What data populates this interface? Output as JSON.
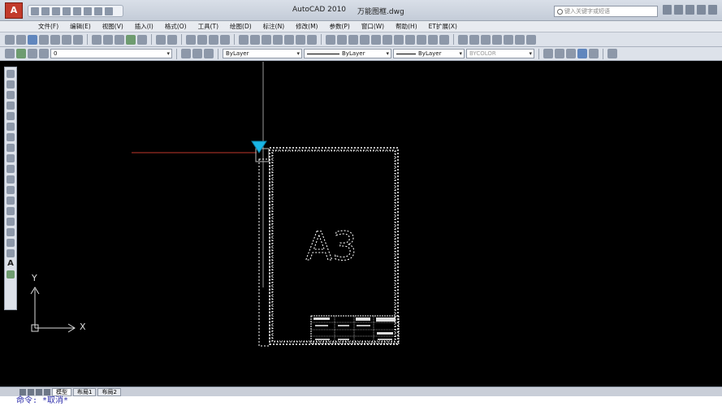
{
  "title": {
    "app": "AutoCAD 2010",
    "file": "万能图框.dwg",
    "search_placeholder": "键入关键字或短语"
  },
  "menu": [
    "文件(F)",
    "编辑(E)",
    "视图(V)",
    "插入(I)",
    "格式(O)",
    "工具(T)",
    "绘图(D)",
    "标注(N)",
    "修改(M)",
    "参数(P)",
    "窗口(W)",
    "帮助(H)",
    "ET扩展(X)"
  ],
  "layer": {
    "current": "0",
    "color": "ByLayer",
    "linetype": "ByLayer",
    "lineweight": "ByLayer",
    "plotstyle": "BYCOLOR"
  },
  "drawing": {
    "frame_label": "A3"
  },
  "ucs": {
    "x_label": "X",
    "y_label": "Y"
  },
  "tabs": [
    "模型",
    "布局1",
    "布局2"
  ],
  "command": {
    "text": "命令: *取消*"
  },
  "colors": {
    "crosshair": "#9a9a9a",
    "xaxis": "#c0392b",
    "grip": "#19b6e6",
    "frame": "#ffffff"
  }
}
